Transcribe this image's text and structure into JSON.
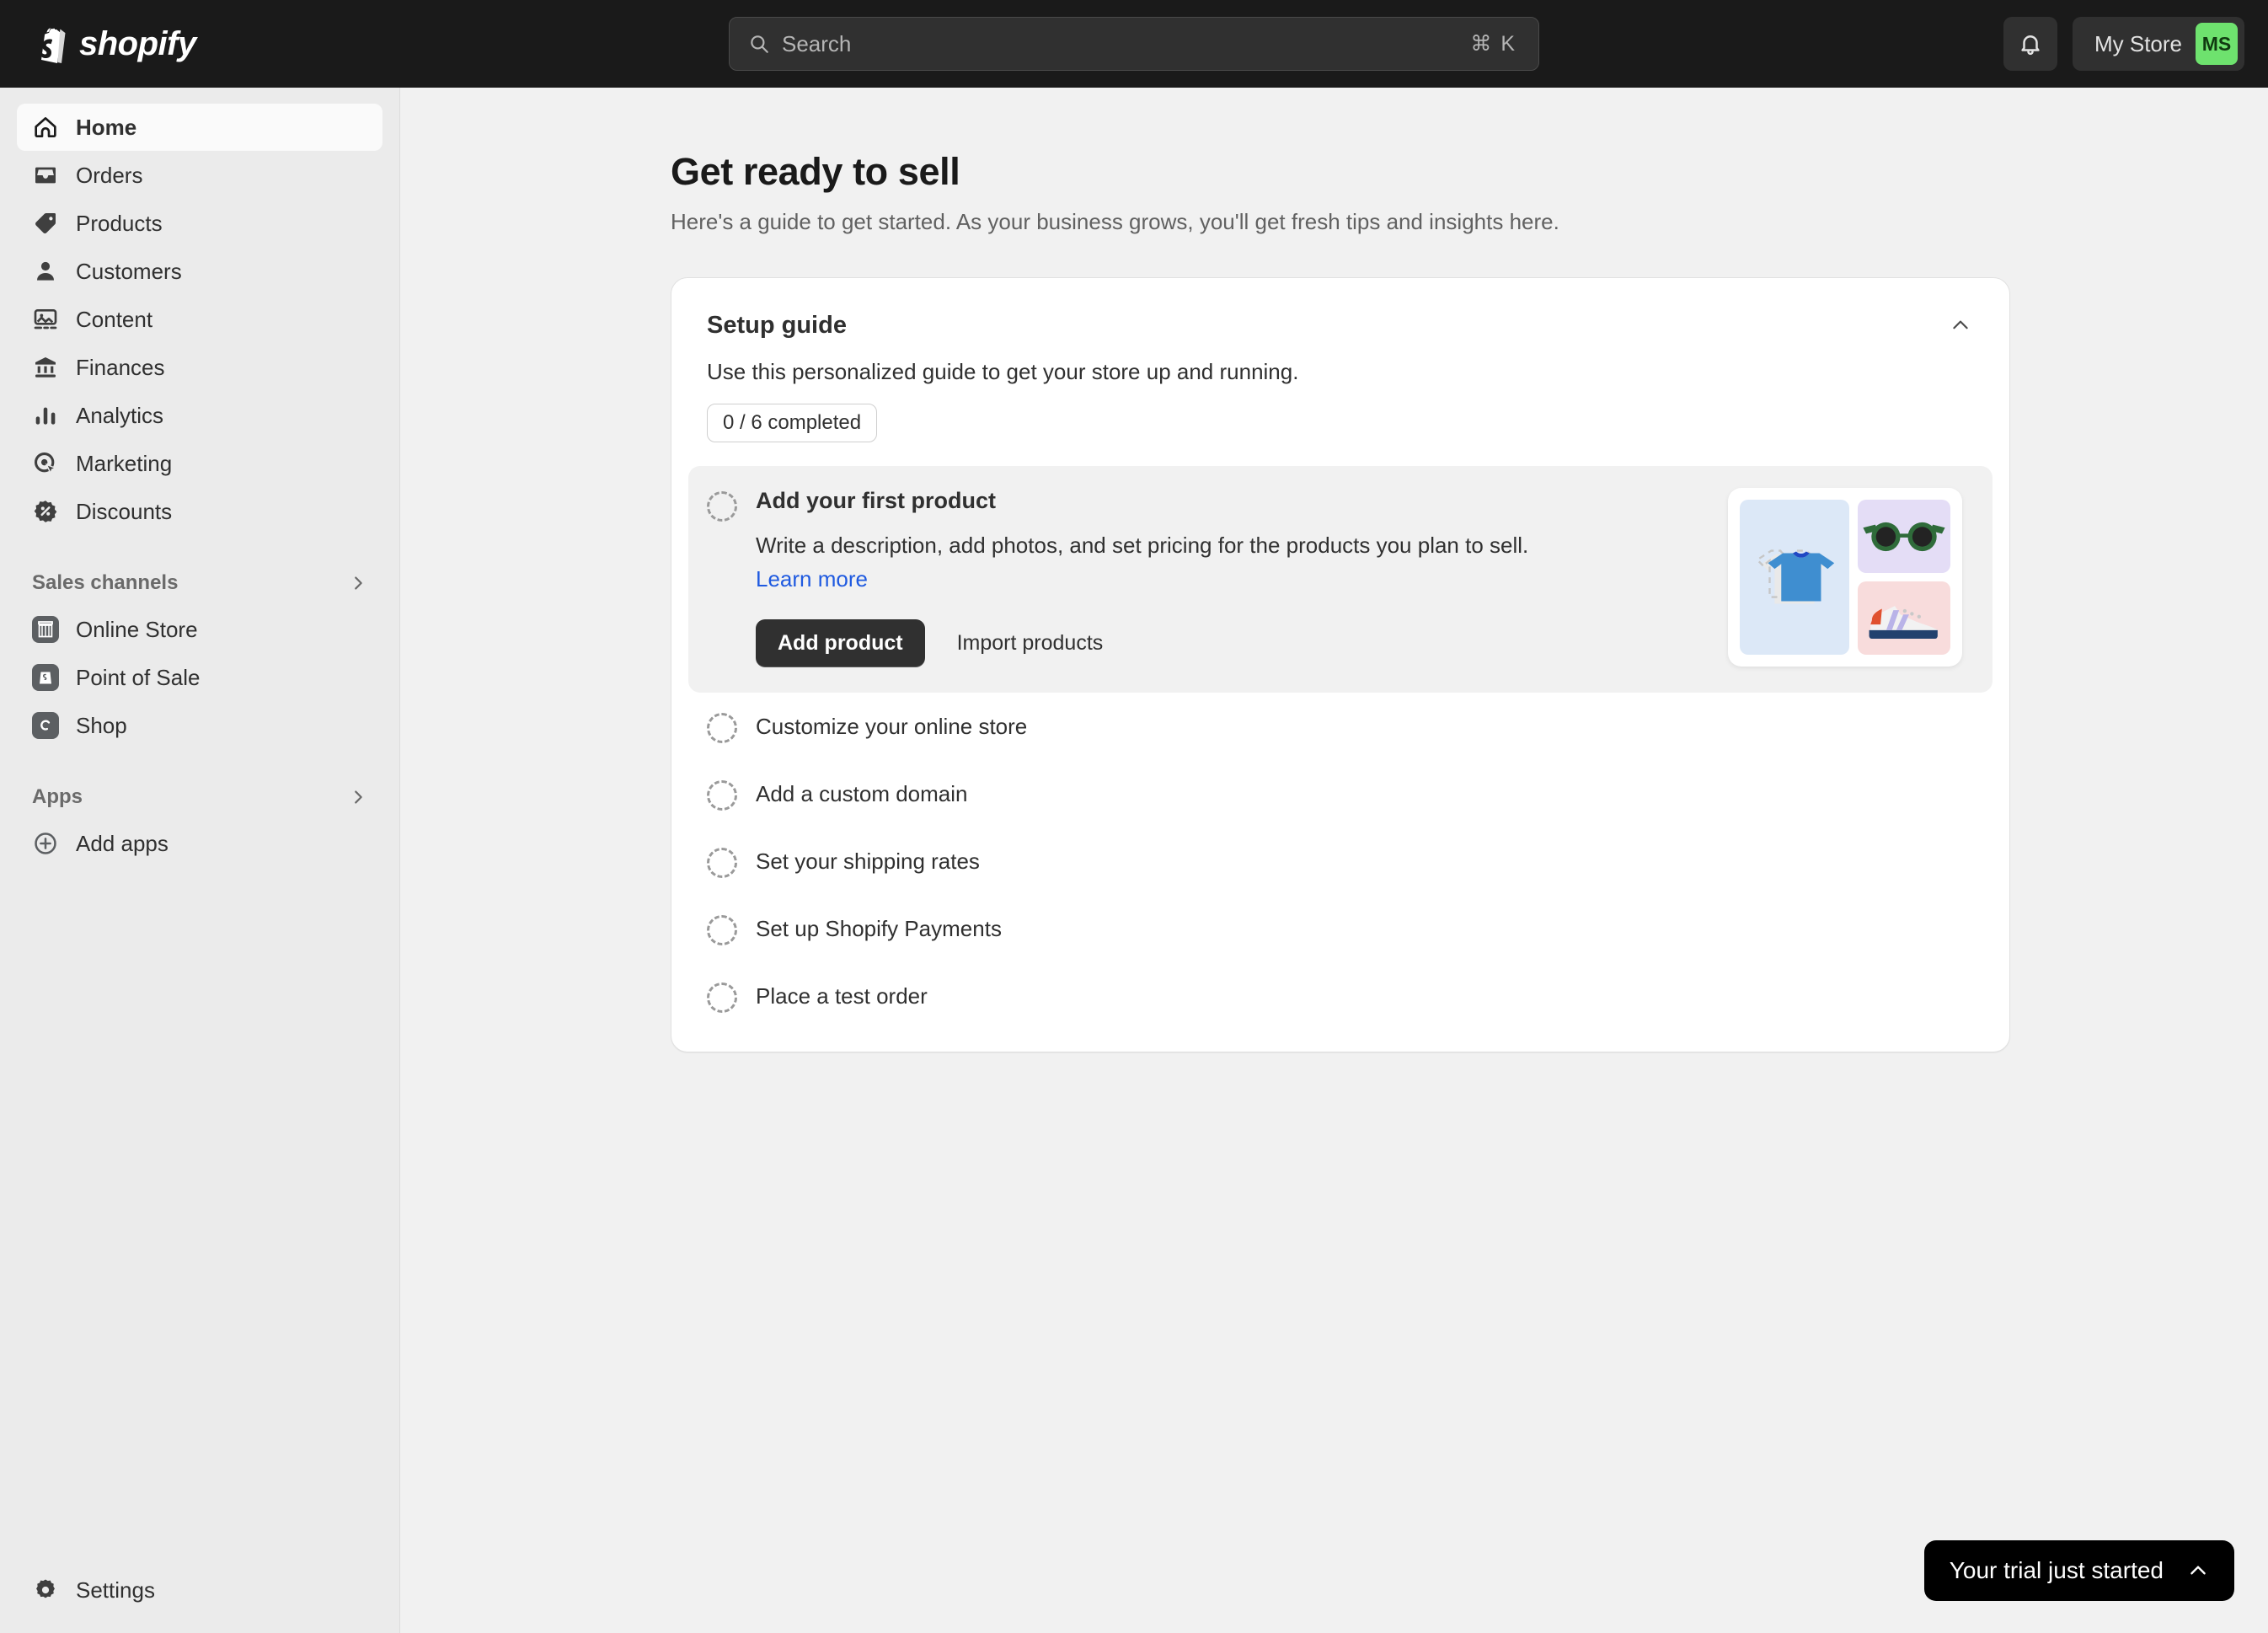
{
  "topbar": {
    "logo_text": "shopify",
    "logo_icon": "shopify-bag-icon",
    "search": {
      "placeholder": "Search",
      "shortcut": "⌘ K",
      "icon": "search-icon"
    },
    "notifications_icon": "bell-icon",
    "store_name": "My Store",
    "avatar_initials": "MS",
    "avatar_color": "#6ee26e"
  },
  "sidebar": {
    "items": [
      {
        "label": "Home",
        "icon": "home-icon",
        "active": true
      },
      {
        "label": "Orders",
        "icon": "orders-icon",
        "active": false
      },
      {
        "label": "Products",
        "icon": "products-tag-icon",
        "active": false
      },
      {
        "label": "Customers",
        "icon": "customers-person-icon",
        "active": false
      },
      {
        "label": "Content",
        "icon": "content-image-icon",
        "active": false
      },
      {
        "label": "Finances",
        "icon": "finances-bank-icon",
        "active": false
      },
      {
        "label": "Analytics",
        "icon": "analytics-bars-icon",
        "active": false
      },
      {
        "label": "Marketing",
        "icon": "marketing-target-icon",
        "active": false
      },
      {
        "label": "Discounts",
        "icon": "discounts-percent-icon",
        "active": false
      }
    ],
    "sales_channels": {
      "title": "Sales channels",
      "items": [
        {
          "label": "Online Store",
          "icon": "online-store-icon"
        },
        {
          "label": "Point of Sale",
          "icon": "point-of-sale-icon"
        },
        {
          "label": "Shop",
          "icon": "shop-icon"
        }
      ]
    },
    "apps": {
      "title": "Apps",
      "items": [
        {
          "label": "Add apps",
          "icon": "add-circle-icon"
        }
      ]
    },
    "settings": {
      "label": "Settings",
      "icon": "gear-icon"
    }
  },
  "main": {
    "page_title": "Get ready to sell",
    "page_subtitle": "Here's a guide to get started. As your business grows, you'll get fresh tips and insights here.",
    "setup_guide": {
      "title": "Setup guide",
      "description": "Use this personalized guide to get your store up and running.",
      "progress_badge": "0 / 6 completed",
      "collapse_icon": "chevron-up-icon",
      "active_task": {
        "title": "Add your first product",
        "description_before_link": "Write a description, add photos, and set pricing for the products you plan to sell. ",
        "link_label": "Learn more",
        "primary_button": "Add product",
        "secondary_button": "Import products",
        "illustration": {
          "shirt_tile_color": "#dce8f7",
          "glasses_tile_color": "#e4ddf6",
          "shoe_tile_color": "#f8dcdc"
        }
      },
      "tasks": [
        {
          "label": "Customize your online store"
        },
        {
          "label": "Add a custom domain"
        },
        {
          "label": "Set your shipping rates"
        },
        {
          "label": "Set up Shopify Payments"
        },
        {
          "label": "Place a test order"
        }
      ]
    }
  },
  "trial_banner": {
    "text": "Your trial just started",
    "icon": "chevron-up-icon"
  }
}
